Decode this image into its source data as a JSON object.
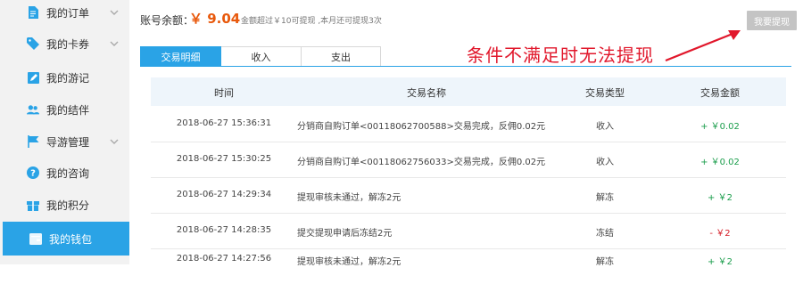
{
  "sidebar": {
    "items": [
      {
        "label": "我的订单",
        "icon": "document-icon",
        "has_submenu": true
      },
      {
        "label": "我的卡券",
        "icon": "tag-icon",
        "has_submenu": true
      },
      {
        "label": "我的游记",
        "icon": "edit-icon",
        "has_submenu": false
      },
      {
        "label": "我的结伴",
        "icon": "users-icon",
        "has_submenu": false
      },
      {
        "label": "导游管理",
        "icon": "flag-icon",
        "has_submenu": true
      },
      {
        "label": "我的咨询",
        "icon": "question-icon",
        "has_submenu": false
      },
      {
        "label": "我的积分",
        "icon": "gift-icon",
        "has_submenu": false
      },
      {
        "label": "我的钱包",
        "icon": "wallet-icon",
        "has_submenu": false,
        "active": true
      }
    ]
  },
  "header": {
    "balance_label": "账号余额：",
    "balance_value": "￥ 9.04",
    "balance_note": "金额超过￥10可提现 ,本月还可提现3次",
    "withdraw_button": "我要提现",
    "annotation": "条件不满足时无法提现"
  },
  "tabs": [
    {
      "label": "交易明细",
      "active": true
    },
    {
      "label": "收入",
      "active": false
    },
    {
      "label": "支出",
      "active": false
    }
  ],
  "table": {
    "columns": [
      "时间",
      "交易名称",
      "交易类型",
      "交易金额"
    ],
    "rows": [
      {
        "time": "2018-06-27 15:36:31",
        "name": "分销商自购订单<00118062700588>交易完成，反佣0.02元",
        "type": "收入",
        "amount": "+ ￥0.02",
        "sign": "pos"
      },
      {
        "time": "2018-06-27 15:30:25",
        "name": "分销商自购订单<00118062756033>交易完成，反佣0.02元",
        "type": "收入",
        "amount": "+ ￥0.02",
        "sign": "pos"
      },
      {
        "time": "2018-06-27 14:29:34",
        "name": "提现审核未通过，解冻2元",
        "type": "解冻",
        "amount": "+ ￥2",
        "sign": "pos"
      },
      {
        "time": "2018-06-27 14:28:35",
        "name": "提交提现申请后冻结2元",
        "type": "冻结",
        "amount": "- ￥2",
        "sign": "neg"
      },
      {
        "time": "2018-06-27 14:27:56",
        "name": "提现审核未通过，解冻2元",
        "type": "解冻",
        "amount": "+ ￥2",
        "sign": "pos"
      }
    ]
  },
  "colors": {
    "accent": "#2aa3e6",
    "balance": "#e8590c",
    "annotation": "#e1172b",
    "positive": "#1a9d4b",
    "negative": "#d6202a"
  }
}
